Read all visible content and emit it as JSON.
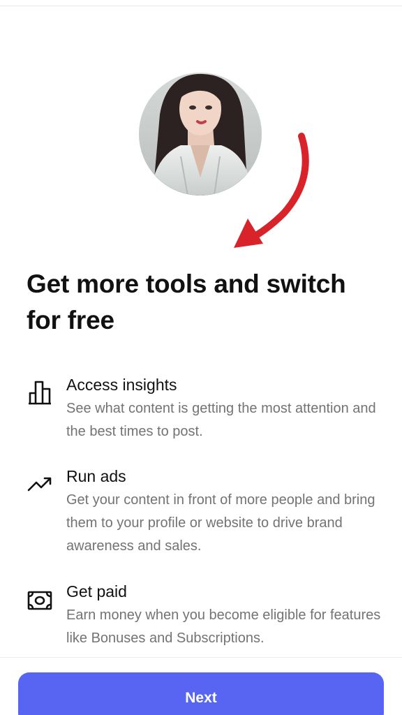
{
  "header": {
    "title_line": "Get more tools and switch for free"
  },
  "features": [
    {
      "icon": "bar-chart-icon",
      "title": "Access insights",
      "description": "See what content is getting the most attention and the best times to post."
    },
    {
      "icon": "trending-up-icon",
      "title": "Run ads",
      "description": "Get your content in front of more people and bring them to your profile or website to drive brand awareness and sales."
    },
    {
      "icon": "money-icon",
      "title": "Get paid",
      "description": "Earn money when you become eligible for features like Bonuses and Subscriptions."
    }
  ],
  "footer": {
    "next_label": "Next"
  },
  "colors": {
    "accent": "#5865f2",
    "arrow": "#d8232a",
    "secondary_text": "#737373"
  }
}
